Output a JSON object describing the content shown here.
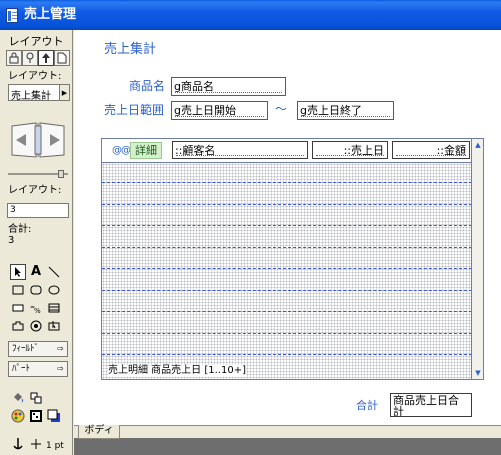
{
  "window": {
    "title": "売上管理"
  },
  "palette": {
    "heading": "レイアウト",
    "layout_label": "レイアウト:",
    "layout_selected": "売上集計",
    "layout_count_label": "レイアウト:",
    "layout_count": "3",
    "total_label": "合計:",
    "total": "3",
    "field_button": "ﾌｨｰﾙﾄﾞ",
    "part_button": "ﾊﾟｰﾄ",
    "line_width": "1 pt"
  },
  "layout": {
    "title": "売上集計",
    "product_name_label": "商品名",
    "product_name_field": "g商品名",
    "date_range_label": "売上日範囲",
    "date_start_field": "g売上日開始",
    "tilde": "～",
    "date_end_field": "g売上日終了",
    "portal": {
      "eyes": "@@",
      "detail": "詳細",
      "customer_field": "::顧客名",
      "sale_date_field": "::売上日",
      "amount_field": "::金額",
      "footer": "売上明細 商品売上日 [1..10+]"
    },
    "total_label": "合計",
    "total_field": "商品売上日合計",
    "part_tab": "ボディ"
  },
  "colors": {
    "accent": "#2b5fd0",
    "row_line": "#3e57d8",
    "detail_bg": "#d4f0cc",
    "titlebar": "#0653d8"
  }
}
